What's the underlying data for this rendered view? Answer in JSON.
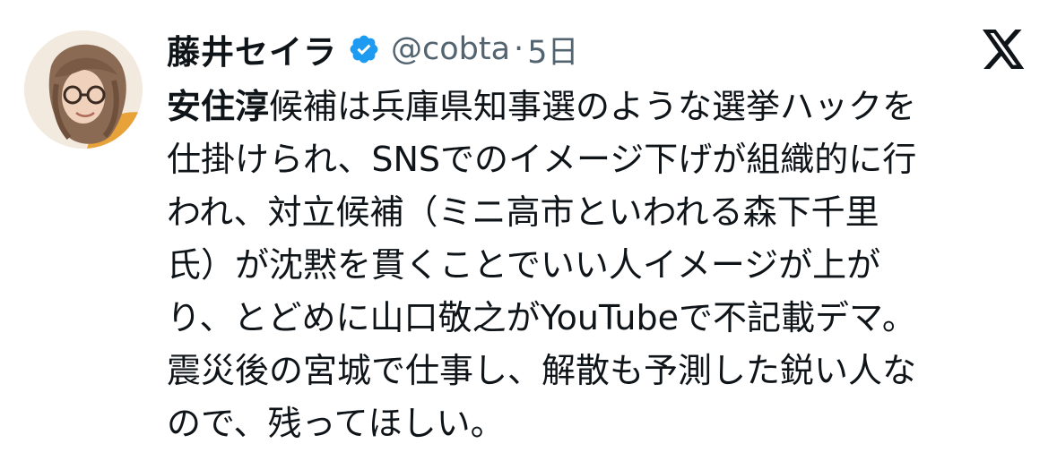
{
  "author": {
    "display_name": "藤井セイラ",
    "handle": "@cobta",
    "separator": "·",
    "timestamp": "5日"
  },
  "colors": {
    "verified_badge": "#1d9bf0",
    "secondary_text": "#536471",
    "primary_text": "#0f1419"
  },
  "icons": {
    "verified": "verified-badge-icon",
    "logo": "x-logo-icon"
  },
  "tweet": {
    "lines": [
      {
        "bold": "安住淳",
        "text": "候補は兵庫県知事選のような選挙ハックを"
      },
      {
        "text": "仕掛けられ、SNSでのイメージ下げが組織的に行"
      },
      {
        "text": "われ、対立候補（ミニ高市といわれる森下千里"
      },
      {
        "text": "氏）が沈黙を貫くことでいい人イメージが上が"
      },
      {
        "text": "り、とどめに山口敬之がYouTubeで不記載デマ。"
      },
      {
        "text": "震災後の宮城で仕事し、解散も予測した鋭い人な"
      },
      {
        "text": "ので、残ってほしい。"
      }
    ]
  }
}
